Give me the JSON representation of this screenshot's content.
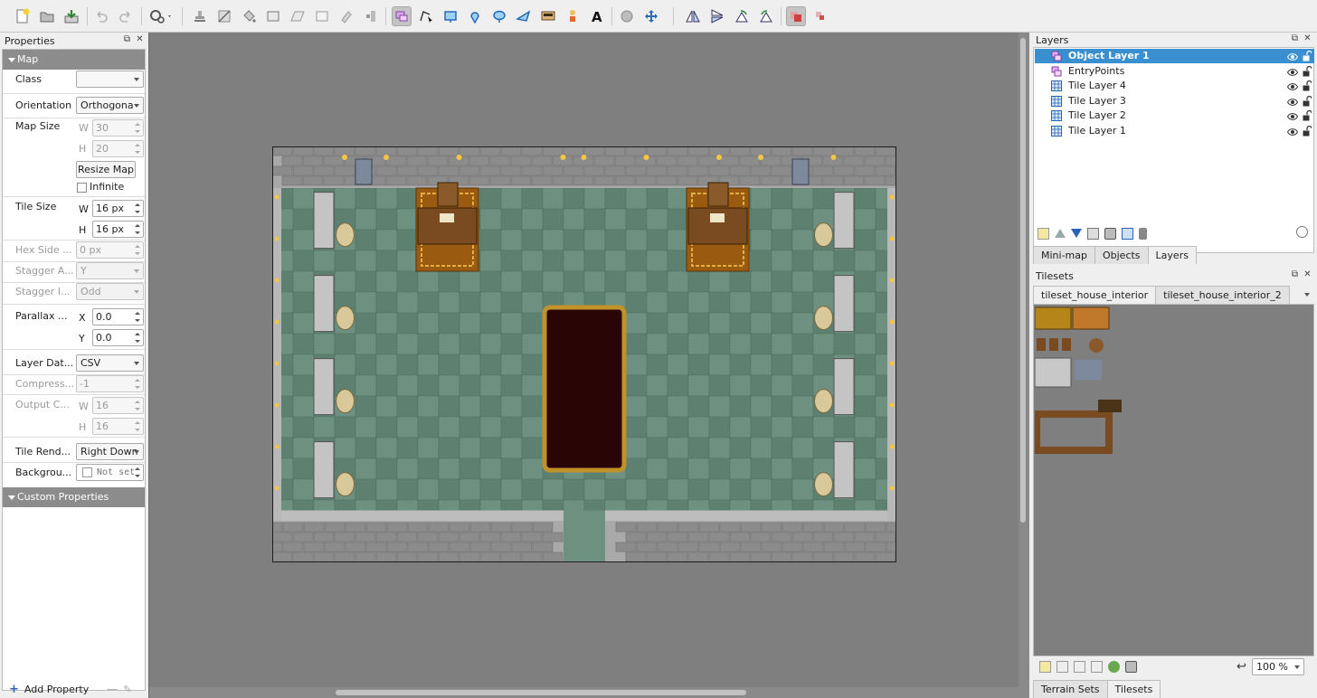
{
  "toolbar": {
    "buttons": [
      "new-map",
      "open",
      "save",
      "undo",
      "redo",
      "command",
      "stamp",
      "terrain",
      "bucket",
      "rectangle",
      "shape-fill",
      "eraser",
      "rect-select",
      "magic-wand",
      "select-same",
      "select-objects",
      "edit-polygons",
      "insert-rectangle",
      "insert-point",
      "insert-ellipse",
      "insert-polygon",
      "insert-tile",
      "insert-template",
      "insert-text",
      "replace-tiles",
      "move",
      "flip-h",
      "flip-v",
      "rotate-left",
      "rotate-right",
      "highlight-layer",
      "show-labels"
    ]
  },
  "properties": {
    "title": "Properties",
    "map_section": "Map",
    "custom_section": "Custom Properties",
    "class_label": "Class",
    "class_value": "",
    "orientation_label": "Orientation",
    "orientation_value": "Orthogona",
    "map_size_label": "Map Size",
    "w": "W",
    "h": "H",
    "map_w": "30",
    "map_h": "20",
    "resize_button": "Resize Map",
    "infinite_label": "Infinite",
    "tile_size_label": "Tile Size",
    "tile_w": "16 px",
    "tile_h": "16 px",
    "hex_label": "Hex Side ...",
    "hex_value": "0 px",
    "stagger_axis_label": "Stagger A...",
    "stagger_axis_value": "Y",
    "stagger_index_label": "Stagger I...",
    "stagger_index_value": "Odd",
    "parallax_label": "Parallax ...",
    "x": "X",
    "y": "Y",
    "parallax_x": "0.0",
    "parallax_y": "0.0",
    "layer_data_label": "Layer Dat...",
    "layer_data_value": "CSV",
    "compress_label": "Compress...",
    "compress_value": "-1",
    "output_label": "Output C...",
    "output_w": "16",
    "output_h": "16",
    "tile_render_label": "Tile Rend...",
    "tile_render_value": "Right Down",
    "background_label": "Backgrou...",
    "background_value": "Not set",
    "add_property": "Add Property"
  },
  "layers": {
    "title": "Layers",
    "items": [
      {
        "name": "Object Layer 1",
        "type": "object",
        "selected": true
      },
      {
        "name": "EntryPoints",
        "type": "object",
        "selected": false
      },
      {
        "name": "Tile Layer 4",
        "type": "tile",
        "selected": false
      },
      {
        "name": "Tile Layer 3",
        "type": "tile",
        "selected": false
      },
      {
        "name": "Tile Layer 2",
        "type": "tile",
        "selected": false
      },
      {
        "name": "Tile Layer 1",
        "type": "tile",
        "selected": false
      }
    ],
    "tabs": [
      "Mini-map",
      "Objects",
      "Layers"
    ],
    "active_tab": "Layers"
  },
  "tilesets": {
    "title": "Tilesets",
    "tabs": [
      "tileset_house_interior",
      "tileset_house_interior_2"
    ],
    "active_tab": "tileset_house_interior",
    "zoom": "100 %",
    "bottom_tabs": [
      "Terrain Sets",
      "Tilesets"
    ],
    "active_bottom_tab": "Tilesets"
  },
  "map": {
    "cols": 30,
    "rows": 20,
    "colors": {
      "floor": "#6e9080",
      "floor_dark": "#5e8070",
      "wall": "#a9a9a9",
      "brick": "#8c8c8c",
      "carpet": "#2a0505",
      "carpet_border": "#c0922a",
      "rug": "#9a5a10"
    }
  }
}
